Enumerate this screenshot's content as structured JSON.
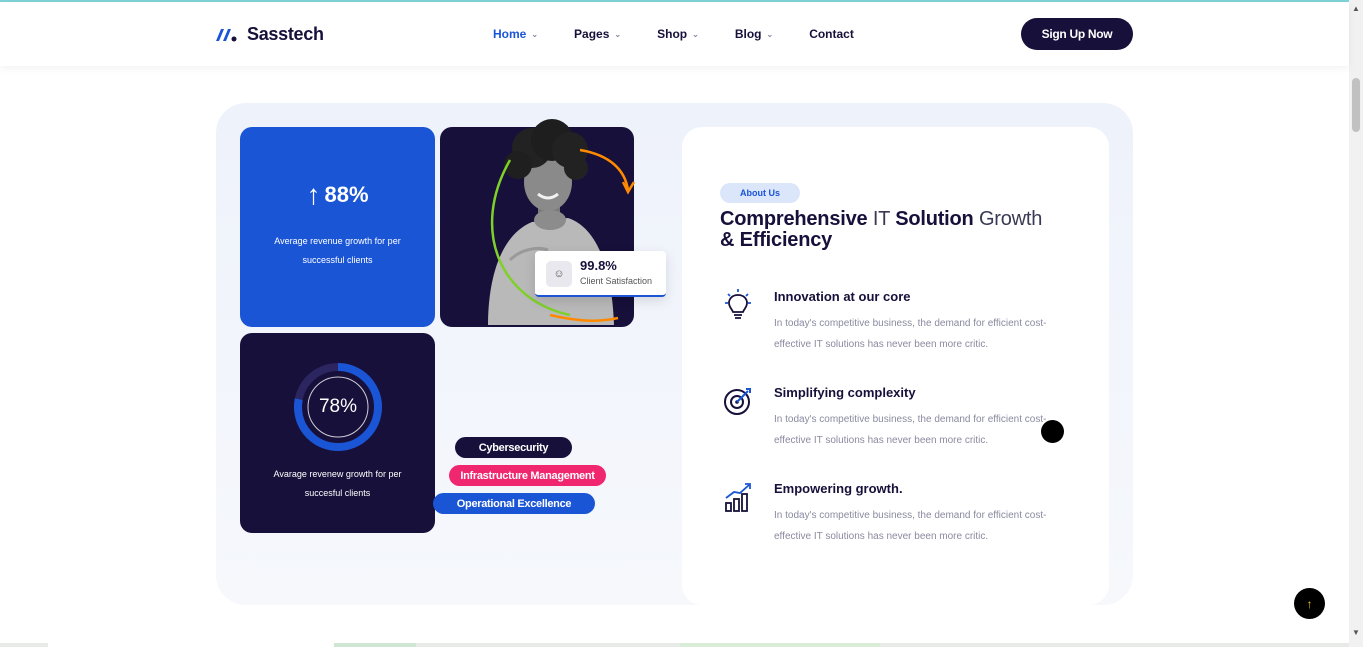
{
  "brand": {
    "name": "Sasstech",
    "color": "#1a55d6",
    "dark": "#16103a"
  },
  "nav": {
    "items": [
      {
        "label": "Home",
        "active": true,
        "dropdown": true
      },
      {
        "label": "Pages",
        "active": false,
        "dropdown": true
      },
      {
        "label": "Shop",
        "active": false,
        "dropdown": true
      },
      {
        "label": "Blog",
        "active": false,
        "dropdown": true
      },
      {
        "label": "Contact",
        "active": false,
        "dropdown": false
      }
    ],
    "cta": "Sign Up Now"
  },
  "stats": {
    "revenue": {
      "value": "88%",
      "icon": "arrow-up-icon",
      "desc": "Average revenue growth for per successful clients"
    },
    "ring": {
      "value": "78%",
      "percent": 78,
      "desc": "Avarage revenew growth for per succesful clients"
    },
    "satisfaction": {
      "value": "99.8%",
      "label": "Client Satisfaction",
      "icon": "smile-icon"
    }
  },
  "tags": [
    "Cybersecurity",
    "Infrastructure Management",
    "Operational Excellence"
  ],
  "tag_colors": [
    "#16103a",
    "#f0266f",
    "#1a55d6"
  ],
  "about": {
    "badge": "About Us",
    "title_parts": {
      "a": "Comprehensive",
      "b": "IT",
      "c": "Solution",
      "d": "Growth",
      "e": "& Efficiency"
    },
    "features": [
      {
        "title": "Innovation at our core",
        "text": "In today's competitive business, the demand for efficient cost-effective IT solutions has never been more critic.",
        "icon": "lightbulb-icon"
      },
      {
        "title": "Simplifying complexity",
        "text": "In today's competitive business, the demand for efficient cost-effective IT solutions has never been more critic.",
        "icon": "target-icon"
      },
      {
        "title": "Empowering growth.",
        "text": "In today's competitive business, the demand for efficient cost-effective IT solutions has never been more critic.",
        "icon": "growth-chart-icon"
      }
    ]
  },
  "to_top": "↑"
}
